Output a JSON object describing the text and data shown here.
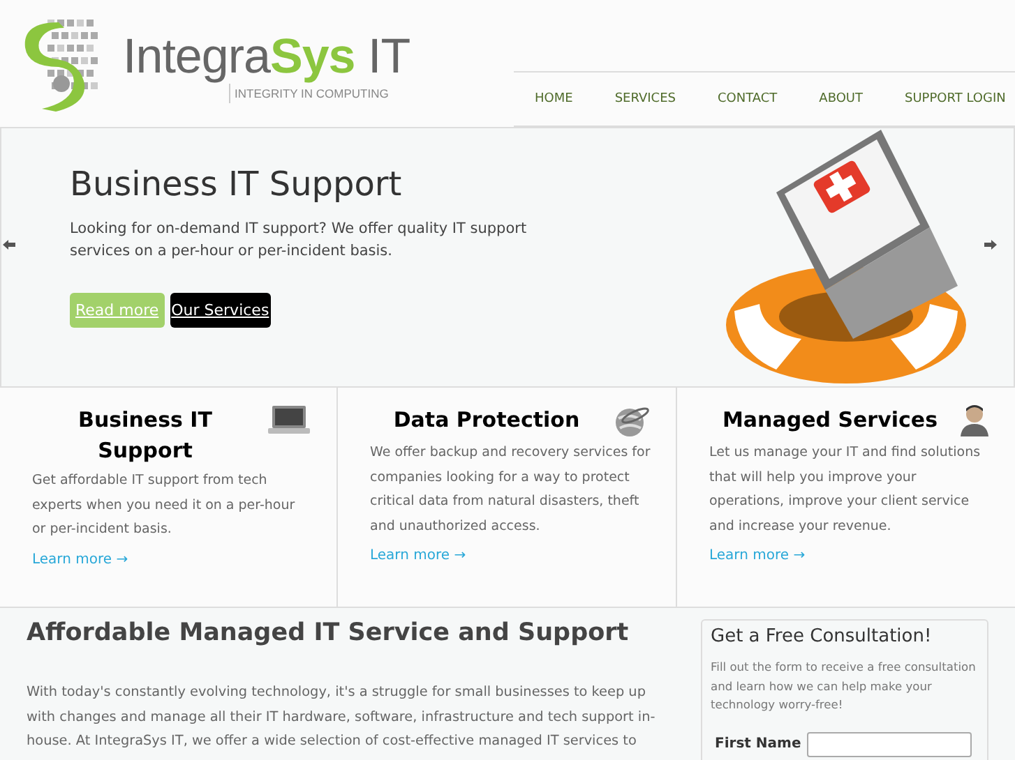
{
  "logo": {
    "name_start": "Integra",
    "name_accent": "Sys",
    "name_end": " IT",
    "tagline": "INTEGRITY IN COMPUTING"
  },
  "nav": [
    {
      "label": "HOME"
    },
    {
      "label": "SERVICES"
    },
    {
      "label": "CONTACT"
    },
    {
      "label": "ABOUT"
    },
    {
      "label": "SUPPORT LOGIN"
    }
  ],
  "hero": {
    "title": "Business IT Support",
    "text": "Looking for on-demand IT support? We offer quality IT support services on a per-hour or per-incident basis.",
    "buttons": [
      {
        "label": "Read more",
        "kind": "primary"
      },
      {
        "label": "Our Services",
        "kind": "dark"
      }
    ]
  },
  "features": [
    {
      "title": "Business IT Support",
      "kind": "laptop",
      "text": "Get affordable IT support from tech experts when you need it on a per-hour or per-incident basis.",
      "link": "Learn more →"
    },
    {
      "title": "Data Protection",
      "kind": "globe",
      "text": "We offer backup and recovery services for companies looking for a way to protect critical data from natural disasters, theft and unauthorized access.",
      "link": "Learn more →"
    },
    {
      "title": "Managed Services",
      "kind": "person",
      "text": "Let us manage your IT and find solutions that will help you improve your operations, improve your client service and increase your revenue.",
      "link": "Learn more →"
    }
  ],
  "main": {
    "title": "Affordable Managed IT Service and Support",
    "text": "With today's constantly evolving technology, it's a struggle for small businesses to keep up with changes and manage all their IT hardware, software, infrastructure and tech support in-house. At IntegraSys IT, we offer a wide selection of cost-effective managed IT services to"
  },
  "consultation": {
    "title": "Get a Free Consultation!",
    "text": "Fill out the form to receive a free consultation and learn how we can help make your technology worry-free!",
    "fields": [
      {
        "label": "First Name"
      }
    ]
  }
}
